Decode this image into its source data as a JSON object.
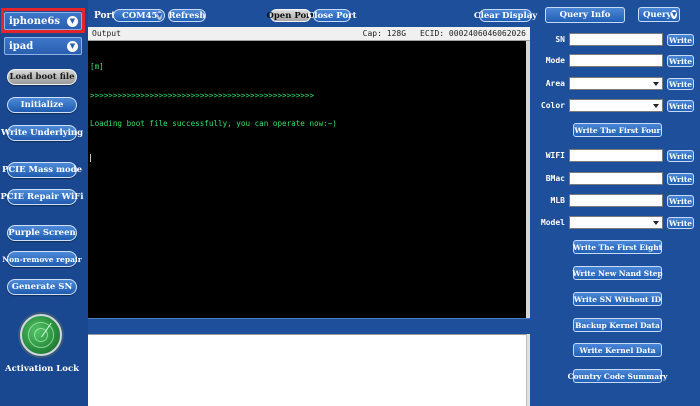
{
  "devices": {
    "primary": "iphone6s",
    "secondary": "ipad"
  },
  "left_buttons": [
    "Load boot file",
    "Initialize",
    "Write Underlying",
    "PCIE Mass mode",
    "PCIE Repair WiFi",
    "Purple Screen",
    "Non-remove repair",
    "Generate SN"
  ],
  "activation_lock_label": "Activation Lock",
  "topbar": {
    "port_label": "Port",
    "port_value": "COM45",
    "refresh": "Refresh",
    "open_port": "Open Port",
    "close_port": "Close Port",
    "clear_display": "Clear Display"
  },
  "output": {
    "header_label": "Output",
    "cap": "Cap: 128G",
    "ecid": "ECID: 0002406046062026",
    "lines": [
      "[m]",
      ">>>>>>>>>>>>>>>>>>>>>>>>>>>>>>>>>>>>>>>>>>>>>>>>>",
      "Loading boot file successfully, you can operate now:~)"
    ]
  },
  "right": {
    "query_info": "Query Info",
    "query": "Query",
    "fields": {
      "sn": "SN",
      "mode": "Mode",
      "area": "Area",
      "color": "Color",
      "wifi": "WIFI",
      "bmac": "BMac",
      "mlb": "MLB",
      "model": "Model"
    },
    "write": "Write",
    "actions": [
      "Write The First Four",
      "Write The First Eight",
      "Write New Nand Step",
      "Write SN Without ID",
      "Backup Kernel Data",
      "Write Kernel Data",
      "Country Code Summary"
    ]
  }
}
